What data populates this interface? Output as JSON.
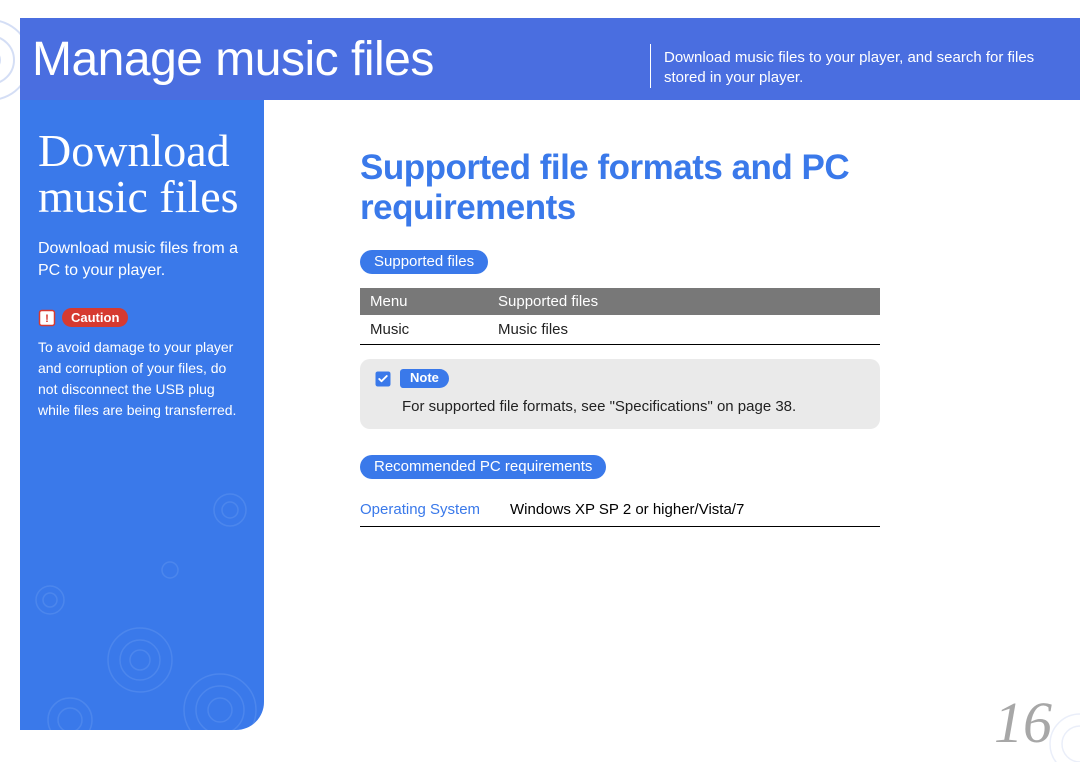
{
  "header": {
    "title": "Manage music files",
    "desc": "Download music files to your player, and search for files stored in your player."
  },
  "sidebar": {
    "title_line1": "Download",
    "title_line2": "music files",
    "sub": "Download music files from a PC to your player.",
    "caution_label": "Caution",
    "caution_text": "To avoid damage to your player and corruption of your files, do not disconnect the USB plug while files are being transferred."
  },
  "main": {
    "title": "Supported file formats and PC requirements",
    "supported_files_label": "Supported files",
    "supported_table": {
      "headers": [
        "Menu",
        "Supported files"
      ],
      "row": [
        "Music",
        "Music files"
      ]
    },
    "note_label": "Note",
    "note_text": "For supported file formats, see \"Specifications\" on page 38.",
    "pc_req_label": "Recommended PC requirements",
    "pc_req_row": {
      "label": "Operating System",
      "value": "Windows XP SP 2 or higher/Vista/7"
    }
  },
  "page_number": "16"
}
